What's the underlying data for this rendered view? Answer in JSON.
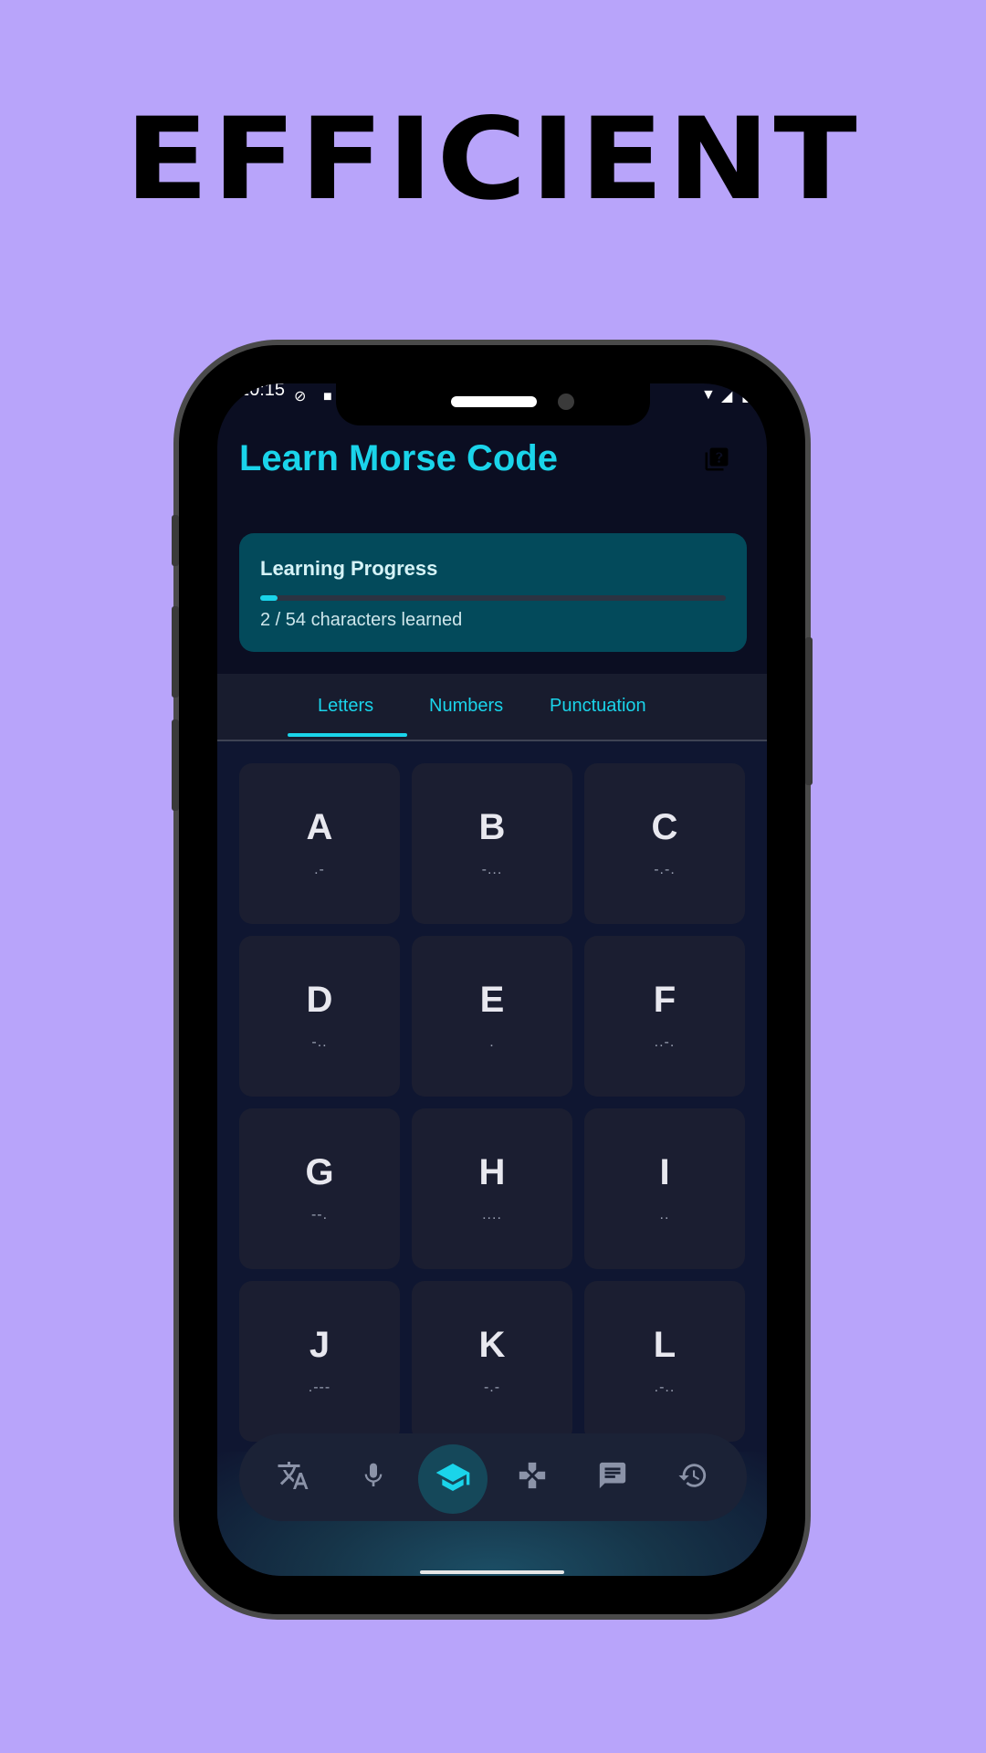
{
  "headline": "EFFICIENT",
  "status_bar": {
    "time": "10:15"
  },
  "app": {
    "title": "Learn Morse Code",
    "progress": {
      "title": "Learning Progress",
      "learned": 2,
      "total": 54,
      "text": "2 / 54 characters learned"
    },
    "tabs": [
      {
        "label": "Letters",
        "selected": true
      },
      {
        "label": "Numbers",
        "selected": false
      },
      {
        "label": "Punctuation",
        "selected": false
      }
    ],
    "characters": [
      {
        "letter": "A",
        "code": ".-"
      },
      {
        "letter": "B",
        "code": "-..."
      },
      {
        "letter": "C",
        "code": "-.-."
      },
      {
        "letter": "D",
        "code": "-.."
      },
      {
        "letter": "E",
        "code": "."
      },
      {
        "letter": "F",
        "code": "..-."
      },
      {
        "letter": "G",
        "code": "--."
      },
      {
        "letter": "H",
        "code": "...."
      },
      {
        "letter": "I",
        "code": ".."
      },
      {
        "letter": "J",
        "code": ".---"
      },
      {
        "letter": "K",
        "code": "-.-"
      },
      {
        "letter": "L",
        "code": ".-.."
      }
    ],
    "bottom_nav": [
      {
        "icon": "translate-icon",
        "active": false
      },
      {
        "icon": "microphone-icon",
        "active": false
      },
      {
        "icon": "graduation-cap-icon",
        "active": true
      },
      {
        "icon": "gamepad-icon",
        "active": false
      },
      {
        "icon": "chat-icon",
        "active": false
      },
      {
        "icon": "history-icon",
        "active": false
      }
    ]
  },
  "colors": {
    "background": "#b8a4fa",
    "accent": "#1ad4ea",
    "screen": "#0b0e22",
    "card": "#1b1e31",
    "progress_card": "#034a5b"
  }
}
